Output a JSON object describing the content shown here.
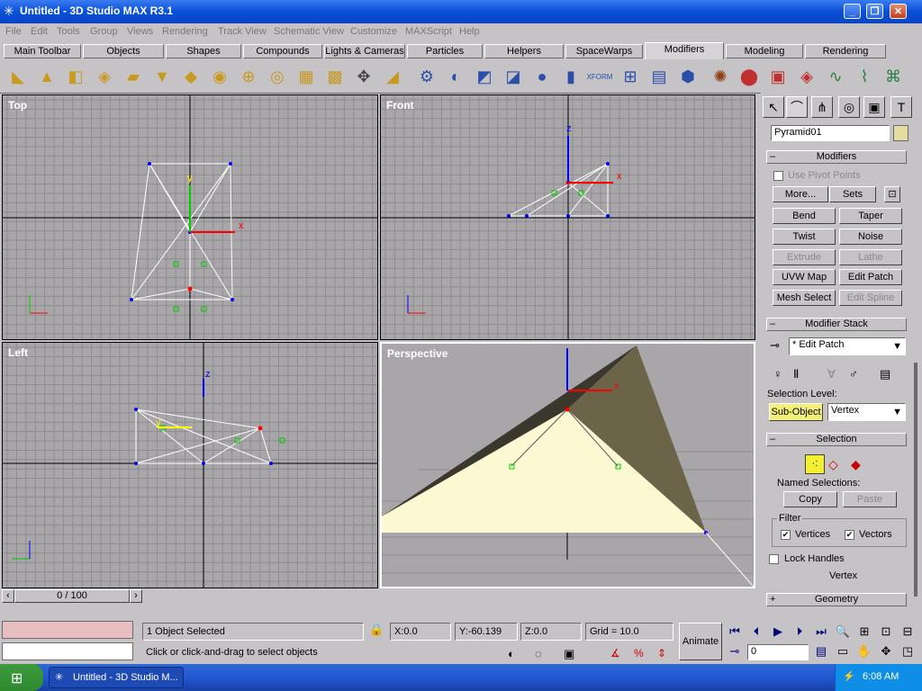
{
  "window": {
    "title": "Untitled - 3D Studio MAX R3.1"
  },
  "menu": [
    "File",
    "Edit",
    "Tools",
    "Group",
    "Views",
    "Rendering",
    "Track View",
    "Schematic View",
    "Customize",
    "MAXScript",
    "Help"
  ],
  "tabs": [
    "Main Toolbar",
    "Objects",
    "Shapes",
    "Compounds",
    "Lights & Cameras",
    "Particles",
    "Helpers",
    "SpaceWarps",
    "Modifiers",
    "Modeling",
    "Rendering"
  ],
  "viewports": {
    "top": "Top",
    "front": "Front",
    "left": "Left",
    "perspective": "Perspective"
  },
  "cmd": {
    "object_name": "Pyramid01",
    "modifiers_title": "Modifiers",
    "use_pivot": "Use Pivot Points",
    "more": "More...",
    "sets": "Sets",
    "buttons": [
      "Bend",
      "Taper",
      "Twist",
      "Noise",
      "Extrude",
      "Lathe",
      "UVW Map",
      "Edit Patch",
      "Mesh Select",
      "Edit Spline"
    ],
    "stack_title": "Modifier Stack",
    "stack_value": "* Edit Patch",
    "selection_level": "Selection Level:",
    "sub_object": "Sub-Object",
    "level_value": "Vertex",
    "selection_title": "Selection",
    "named_sel": "Named Selections:",
    "copy": "Copy",
    "paste": "Paste",
    "filter": "Filter",
    "vertices": "Vertices",
    "vectors": "Vectors",
    "lock_handles": "Lock Handles",
    "vertex_label": "Vertex",
    "geometry_title": "Geometry"
  },
  "timeline": {
    "frame": "0 / 100"
  },
  "status": {
    "selected": "1 Object Selected",
    "prompt": "Click or click-and-drag to select objects",
    "x": "X:0.0",
    "y": "Y:-60.139",
    "z": "Z:0.0",
    "grid": "Grid = 10.0",
    "animate": "Animate",
    "frame_field": "0"
  },
  "taskbar": {
    "item": "Untitled - 3D Studio M...",
    "time": "6:08 AM"
  },
  "colors": {
    "viewport_bg": "#a8a6a8",
    "grid": "#8e8c8e",
    "axis": "#000000",
    "pyramid_face": "#fbf8d2",
    "pyramid_dark": "#6b6448",
    "select": "#ff0000"
  }
}
